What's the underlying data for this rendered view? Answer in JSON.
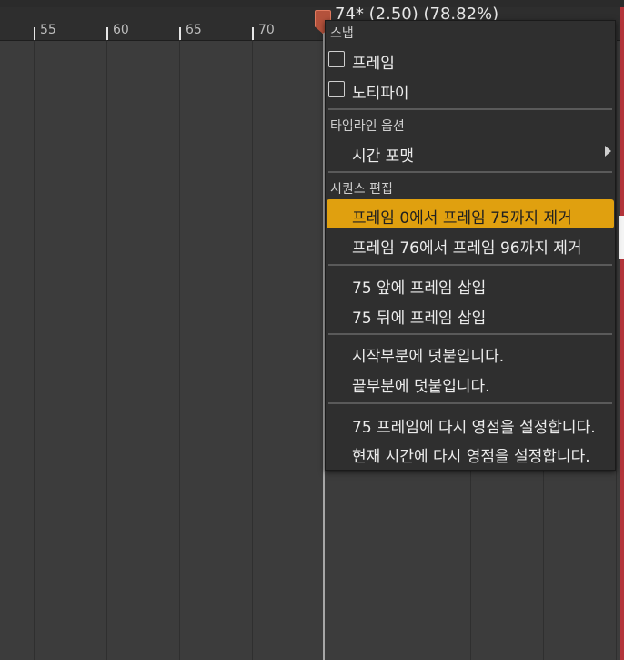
{
  "timeline": {
    "ticks": [
      {
        "label": "55"
      },
      {
        "label": "60"
      },
      {
        "label": "65"
      },
      {
        "label": "70"
      }
    ],
    "playhead_readout": "74* (2.50) (78.82%)"
  },
  "context_menu": {
    "snap_header": "스냅",
    "snap_items": [
      {
        "label": "프레임",
        "checked": false
      },
      {
        "label": "노티파이",
        "checked": false
      }
    ],
    "timeline_options_header": "타임라인 옵션",
    "time_format_label": "시간 포맷",
    "sequence_edit_header": "시퀀스 편집",
    "items": [
      {
        "label": "프레임 0에서 프레임 75까지 제거"
      },
      {
        "label": "프레임 76에서 프레임 96까지 제거"
      },
      {
        "label": "75 앞에 프레임 삽입"
      },
      {
        "label": "75 뒤에 프레임 삽입"
      },
      {
        "label": "시작부분에 덧붙입니다."
      },
      {
        "label": "끝부분에 덧붙입니다."
      },
      {
        "label": "75 프레임에 다시 영점을 설정합니다."
      },
      {
        "label": "현재 시간에 다시 영점을 설정합니다."
      }
    ]
  },
  "colors": {
    "highlight": "#e0a00f",
    "playhead": "#b4523c",
    "right_edge": "#b4343a"
  },
  "icons": {
    "submenu": "triangle-right-icon",
    "checkbox": "checkbox-icon"
  }
}
